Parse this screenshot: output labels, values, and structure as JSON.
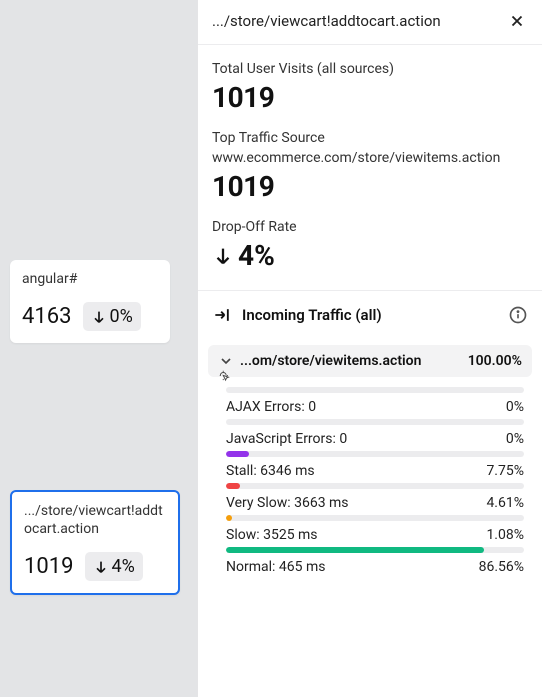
{
  "left": {
    "card1": {
      "title": "angular#",
      "value": "4163",
      "delta": "0%"
    },
    "card2": {
      "title": ".../store/viewcart!addtocart.action",
      "value": "1019",
      "delta": "4%"
    }
  },
  "panel": {
    "title": ".../store/viewcart!addtocart.action",
    "total_label": "Total User Visits (all sources)",
    "total_value": "1019",
    "top_source_label": "Top Traffic Source",
    "top_source_url": "www.ecommerce.com/store/viewitems.action",
    "top_source_value": "1019",
    "drop_label": "Drop-Off Rate",
    "drop_value": "4%",
    "incoming_label": "Incoming Traffic (all)",
    "source": {
      "name": "...om/store/viewitems.action",
      "pct": "100.00%"
    },
    "metrics": [
      {
        "label": "AJAX Errors: 0",
        "pct": "0%",
        "fill": 0,
        "color": "#9333ea"
      },
      {
        "label": "JavaScript Errors: 0",
        "pct": "0%",
        "fill": 0,
        "color": "#9333ea"
      },
      {
        "label": "Stall: 6346 ms",
        "pct": "7.75%",
        "fill": 7.75,
        "color": "#9333ea"
      },
      {
        "label": "Very Slow: 3663 ms",
        "pct": "4.61%",
        "fill": 4.61,
        "color": "#ef4444"
      },
      {
        "label": "Slow: 3525 ms",
        "pct": "1.08%",
        "fill": 1.08,
        "color": "#f59e0b"
      },
      {
        "label": "Normal: 465 ms",
        "pct": "86.56%",
        "fill": 86.56,
        "color": "#10b981"
      }
    ]
  }
}
